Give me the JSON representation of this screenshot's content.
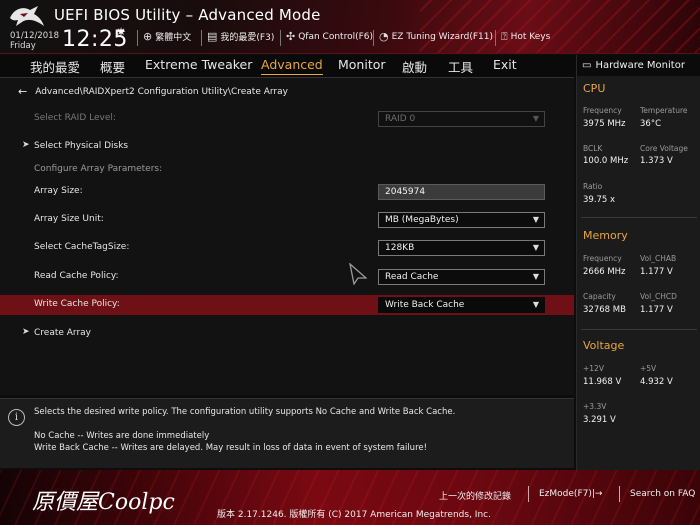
{
  "header": {
    "title": "UEFI BIOS Utility – Advanced Mode",
    "date": "01/12/2018",
    "day": "Friday",
    "time": "12:25",
    "buttons": [
      {
        "label": "繁體中文"
      },
      {
        "label": "我的最愛(F3)"
      },
      {
        "label": "Qfan Control(F6)"
      },
      {
        "label": "EZ Tuning Wizard(F11)"
      },
      {
        "label": "Hot Keys"
      }
    ]
  },
  "nav": {
    "tabs": [
      {
        "label": "我的最愛"
      },
      {
        "label": "概要"
      },
      {
        "label": "Extreme Tweaker"
      },
      {
        "label": "Advanced"
      },
      {
        "label": "Monitor"
      },
      {
        "label": "啟動"
      },
      {
        "label": "工具"
      },
      {
        "label": "Exit"
      }
    ],
    "active": "Advanced"
  },
  "breadcrumb": "Advanced\\RAIDXpert2 Configuration Utility\\Create Array",
  "settings": {
    "raid_level": {
      "label": "Select RAID Level:",
      "value": "RAID 0"
    },
    "physical_disks": {
      "label": "Select Physical Disks"
    },
    "configure_header": {
      "label": "Configure Array Parameters:"
    },
    "array_size": {
      "label": "Array Size:",
      "value": "2045974"
    },
    "array_size_unit": {
      "label": "Array Size Unit:",
      "value": "MB (MegaBytes)"
    },
    "cache_tag_size": {
      "label": "Select CacheTagSize:",
      "value": "128KB"
    },
    "read_cache": {
      "label": "Read Cache Policy:",
      "value": "Read Cache"
    },
    "write_cache": {
      "label": "Write Cache Policy:",
      "value": "Write Back Cache"
    },
    "create_array": {
      "label": "Create Array"
    }
  },
  "help": {
    "line1": "Selects the desired write policy.  The configuration utility supports No Cache and Write Back Cache.",
    "line2": "No Cache -- Writes are done immediately",
    "line3": "Write Back Cache -- Writes are delayed.  May result in loss of data in event of system failure!"
  },
  "hw_monitor": {
    "title": "Hardware Monitor",
    "cpu": {
      "title": "CPU",
      "frequency_label": "Frequency",
      "frequency": "3975 MHz",
      "temperature_label": "Temperature",
      "temperature": "36°C",
      "bclk_label": "BCLK",
      "bclk": "100.0 MHz",
      "core_voltage_label": "Core Voltage",
      "core_voltage": "1.373 V",
      "ratio_label": "Ratio",
      "ratio": "39.75 x"
    },
    "memory": {
      "title": "Memory",
      "frequency_label": "Frequency",
      "frequency": "2666 MHz",
      "vol_chab_label": "Vol_CHAB",
      "vol_chab": "1.177 V",
      "capacity_label": "Capacity",
      "capacity": "32768 MB",
      "vol_chcd_label": "Vol_CHCD",
      "vol_chcd": "1.177 V"
    },
    "voltage": {
      "title": "Voltage",
      "v12_label": "+12V",
      "v12": "11.968 V",
      "v5_label": "+5V",
      "v5": "4.932 V",
      "v33_label": "+3.3V",
      "v33": "3.291 V"
    }
  },
  "footer": {
    "brand": "原價屋Coolpc",
    "last_modified": "上一次的修改記錄",
    "ezmode": "EzMode(F7)|→",
    "search_faq": "Search on FAQ",
    "version": "版本 2.17.1246. 版權所有 (C) 2017 American Megatrends, Inc."
  },
  "colors": {
    "accent": "#e8a640",
    "highlight_row": "#6e1016",
    "header_red": "#6a0d16"
  }
}
